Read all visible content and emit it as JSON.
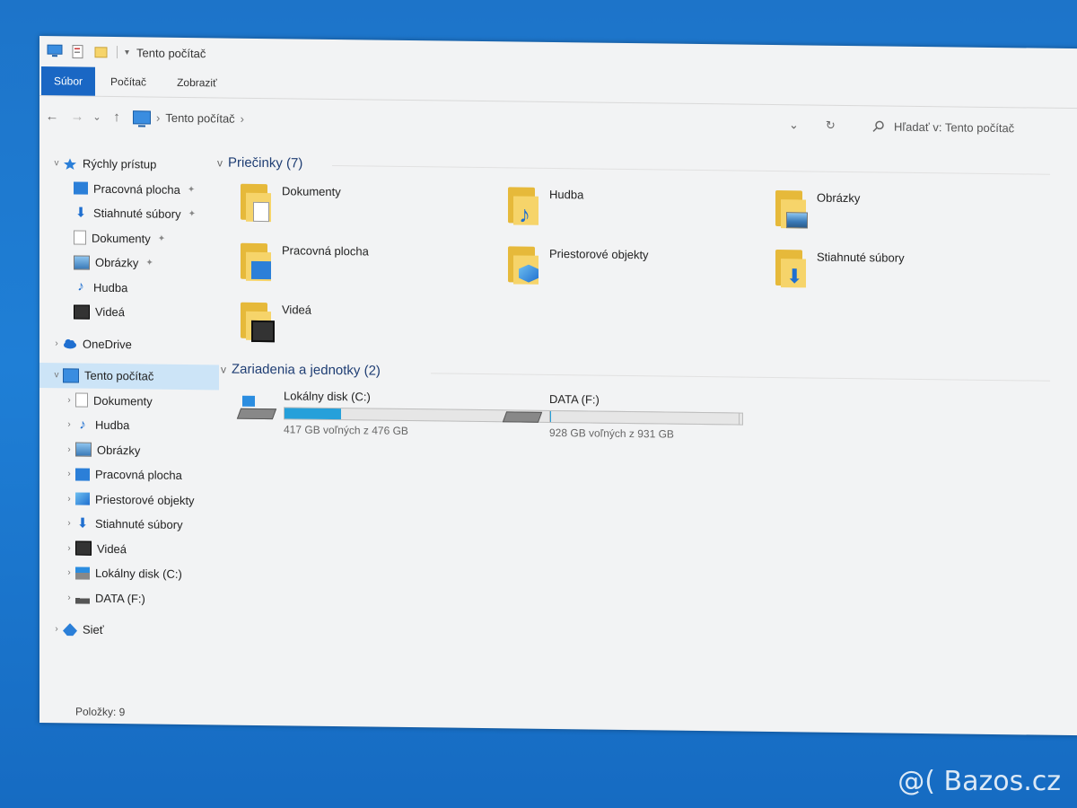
{
  "window": {
    "title": "Tento počítač"
  },
  "ribbon": {
    "tabs": [
      "Súbor",
      "Počítač",
      "Zobraziť"
    ]
  },
  "nav": {
    "back": "←",
    "forward": "→",
    "recent": "⌄",
    "up": "↑",
    "refresh": "↻",
    "dropdown": "⌄"
  },
  "address": {
    "path": "Tento počítač",
    "arrow": "›"
  },
  "search": {
    "placeholder": "Hľadať v: Tento počítač"
  },
  "sidebar": {
    "quick_access": {
      "label": "Rýchly prístup",
      "items": [
        {
          "label": "Pracovná plocha",
          "icon": "desktop-icon"
        },
        {
          "label": "Stiahnuté súbory",
          "icon": "downloads-icon"
        },
        {
          "label": "Dokumenty",
          "icon": "documents-icon"
        },
        {
          "label": "Obrázky",
          "icon": "pictures-icon"
        },
        {
          "label": "Hudba",
          "icon": "music-icon"
        },
        {
          "label": "Videá",
          "icon": "videos-icon"
        }
      ]
    },
    "onedrive": "OneDrive",
    "this_pc": {
      "label": "Tento počítač",
      "items": [
        {
          "label": "Dokumenty",
          "icon": "documents-icon"
        },
        {
          "label": "Hudba",
          "icon": "music-icon"
        },
        {
          "label": "Obrázky",
          "icon": "pictures-icon"
        },
        {
          "label": "Pracovná plocha",
          "icon": "desktop-icon"
        },
        {
          "label": "Priestorové objekty",
          "icon": "3d-objects-icon"
        },
        {
          "label": "Stiahnuté súbory",
          "icon": "downloads-icon"
        },
        {
          "label": "Videá",
          "icon": "videos-icon"
        },
        {
          "label": "Lokálny disk (C:)",
          "icon": "drive-icon"
        },
        {
          "label": "DATA (F:)",
          "icon": "drive-icon"
        }
      ]
    },
    "network": "Sieť"
  },
  "content": {
    "folders_header": "Priečinky (7)",
    "folders": [
      "Dokumenty",
      "Hudba",
      "Obrázky",
      "Pracovná plocha",
      "Priestorové objekty",
      "Stiahnuté súbory",
      "Videá"
    ],
    "drives_header": "Zariadenia a jednotky (2)",
    "drives": [
      {
        "name": "Lokálny disk (C:)",
        "free": "417 GB voľných z 476 GB",
        "used_fraction": 0.124
      },
      {
        "name": "DATA (F:)",
        "free": "928 GB voľných z 931 GB",
        "used_fraction": 0.003
      }
    ]
  },
  "status": {
    "items": "Položky: 9"
  },
  "watermark": "@( Bazos.cz",
  "colors": {
    "accent": "#1a67c4",
    "folder": "#f6d46a",
    "bar": "#26a0da"
  }
}
